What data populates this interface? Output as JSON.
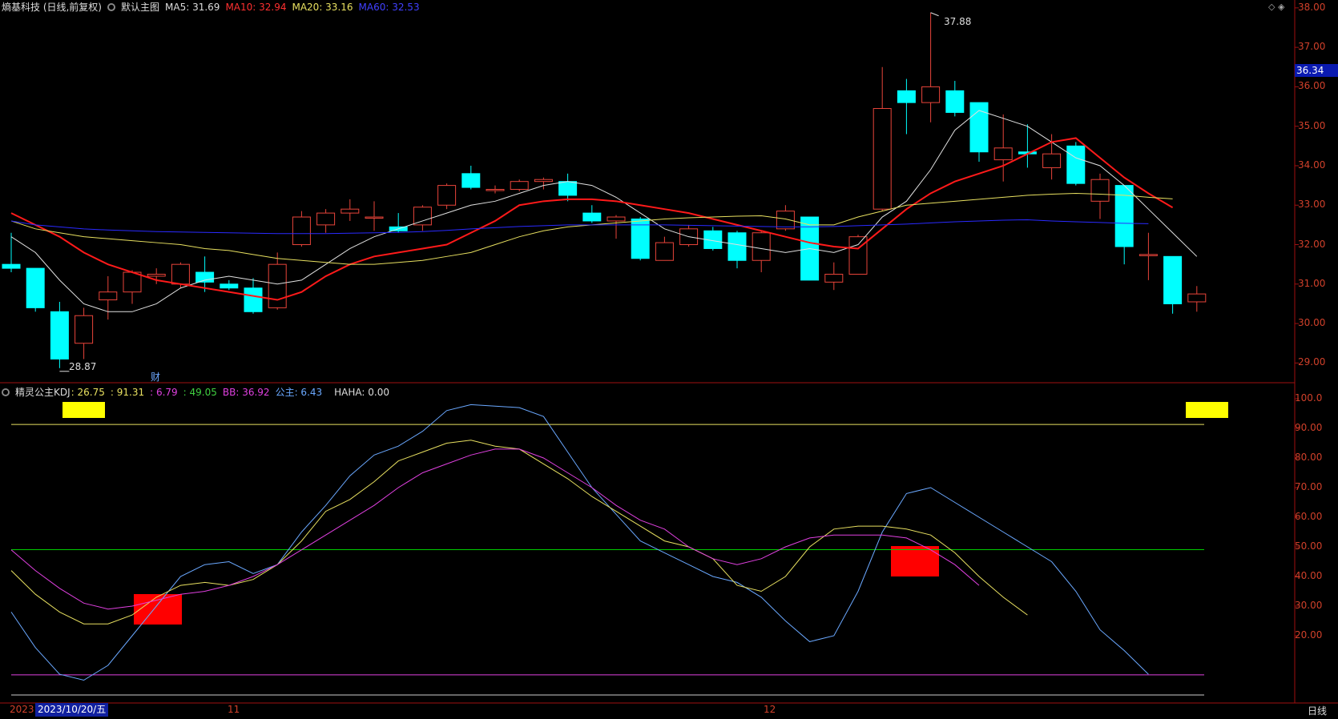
{
  "header": {
    "stock_title": "熵基科技 (日线,前复权)",
    "main_chart_btn": "默认主图",
    "ma5": "MA5: 31.69",
    "ma10": "MA10: 32.94",
    "ma20": "MA20: 33.16",
    "ma60": "MA60: 32.53",
    "window_controls": "◇ ◈"
  },
  "indicator_header": {
    "name": "精灵公主KDJ",
    "v1": ": 26.75",
    "v2": ": 91.31",
    "v3": ": 6.79",
    "v4": ": 49.05",
    "bb": "BB: 36.92",
    "gongzhu": "公主: 6.43",
    "haha": "HAHA: 0.00"
  },
  "colors": {
    "up": "#e8443a",
    "down": "#00ffff",
    "ma5": "#e0e0e0",
    "ma10": "#ff1a1a",
    "ma20": "#e8e060",
    "ma60": "#2a2aff",
    "k": "#6aa8ff",
    "d": "#e8e060",
    "j": "#e040e0",
    "mid": "#00cc00",
    "marker_red": "#ff0000",
    "marker_yellow": "#ffff00"
  },
  "annotations": {
    "high": "37.88",
    "low": "28.87",
    "fin_marker": "财"
  },
  "price_axis": {
    "current": "36.34"
  },
  "x_axis": {
    "labels": [
      "2023",
      "11",
      "12"
    ],
    "cursor_date": "2023/10/20/五",
    "cycle": "日线"
  },
  "chart_data": [
    {
      "type": "candlestick",
      "title": "熵基科技 (日线,前复权)",
      "ylim": [
        28.5,
        38.2
      ],
      "yticks": [
        "38.00",
        "37.00",
        "36.00",
        "35.00",
        "34.00",
        "33.00",
        "32.00",
        "31.00",
        "30.00",
        "29.00"
      ],
      "candles": [
        {
          "o": 31.5,
          "c": 31.4,
          "h": 32.3,
          "l": 31.3
        },
        {
          "o": 31.4,
          "c": 30.4,
          "h": 31.4,
          "l": 30.3
        },
        {
          "o": 30.3,
          "c": 29.1,
          "h": 30.55,
          "l": 28.87
        },
        {
          "o": 29.5,
          "c": 30.2,
          "h": 30.4,
          "l": 29.1
        },
        {
          "o": 30.6,
          "c": 30.8,
          "h": 31.2,
          "l": 30.1
        },
        {
          "o": 30.8,
          "c": 31.3,
          "h": 31.35,
          "l": 30.5
        },
        {
          "o": 31.2,
          "c": 31.25,
          "h": 31.4,
          "l": 31.0
        },
        {
          "o": 31.0,
          "c": 31.5,
          "h": 31.55,
          "l": 30.9
        },
        {
          "o": 31.3,
          "c": 31.05,
          "h": 31.7,
          "l": 30.8
        },
        {
          "o": 31.0,
          "c": 30.9,
          "h": 31.1,
          "l": 30.85
        },
        {
          "o": 30.9,
          "c": 30.3,
          "h": 31.15,
          "l": 30.25
        },
        {
          "o": 30.4,
          "c": 31.5,
          "h": 31.8,
          "l": 30.35
        },
        {
          "o": 32.0,
          "c": 32.7,
          "h": 32.85,
          "l": 31.95
        },
        {
          "o": 32.5,
          "c": 32.8,
          "h": 32.9,
          "l": 32.3
        },
        {
          "o": 32.8,
          "c": 32.9,
          "h": 33.15,
          "l": 32.6
        },
        {
          "o": 32.7,
          "c": 32.7,
          "h": 33.1,
          "l": 32.35
        },
        {
          "o": 32.45,
          "c": 32.35,
          "h": 32.8,
          "l": 32.3
        },
        {
          "o": 32.5,
          "c": 32.95,
          "h": 33.0,
          "l": 32.35
        },
        {
          "o": 33.0,
          "c": 33.5,
          "h": 33.55,
          "l": 32.9
        },
        {
          "o": 33.8,
          "c": 33.45,
          "h": 34.0,
          "l": 33.4
        },
        {
          "o": 33.4,
          "c": 33.4,
          "h": 33.5,
          "l": 33.3
        },
        {
          "o": 33.4,
          "c": 33.6,
          "h": 33.65,
          "l": 33.35
        },
        {
          "o": 33.6,
          "c": 33.65,
          "h": 33.7,
          "l": 33.4
        },
        {
          "o": 33.6,
          "c": 33.25,
          "h": 33.8,
          "l": 33.1
        },
        {
          "o": 32.8,
          "c": 32.6,
          "h": 33.0,
          "l": 32.55
        },
        {
          "o": 32.6,
          "c": 32.7,
          "h": 32.75,
          "l": 32.15
        },
        {
          "o": 32.65,
          "c": 31.65,
          "h": 32.7,
          "l": 31.6
        },
        {
          "o": 31.6,
          "c": 32.05,
          "h": 32.2,
          "l": 31.6
        },
        {
          "o": 32.0,
          "c": 32.4,
          "h": 32.5,
          "l": 31.95
        },
        {
          "o": 32.35,
          "c": 31.9,
          "h": 32.45,
          "l": 31.85
        },
        {
          "o": 32.3,
          "c": 31.6,
          "h": 32.35,
          "l": 31.4
        },
        {
          "o": 31.6,
          "c": 32.3,
          "h": 32.35,
          "l": 31.3
        },
        {
          "o": 32.4,
          "c": 32.85,
          "h": 33.0,
          "l": 32.35
        },
        {
          "o": 32.7,
          "c": 31.1,
          "h": 32.7,
          "l": 31.1
        },
        {
          "o": 31.05,
          "c": 31.25,
          "h": 31.55,
          "l": 30.85
        },
        {
          "o": 31.25,
          "c": 32.2,
          "h": 32.25,
          "l": 31.25
        },
        {
          "o": 32.9,
          "c": 35.45,
          "h": 36.5,
          "l": 32.85
        },
        {
          "o": 35.9,
          "c": 35.6,
          "h": 36.2,
          "l": 34.8
        },
        {
          "o": 35.6,
          "c": 36.0,
          "h": 37.88,
          "l": 35.1
        },
        {
          "o": 35.9,
          "c": 35.35,
          "h": 36.15,
          "l": 35.25
        },
        {
          "o": 35.6,
          "c": 34.35,
          "h": 35.6,
          "l": 34.1
        },
        {
          "o": 34.15,
          "c": 34.45,
          "h": 35.3,
          "l": 33.6
        },
        {
          "o": 34.35,
          "c": 34.3,
          "h": 35.05,
          "l": 33.95
        },
        {
          "o": 33.95,
          "c": 34.3,
          "h": 34.8,
          "l": 33.65
        },
        {
          "o": 34.5,
          "c": 33.55,
          "h": 34.6,
          "l": 33.5
        },
        {
          "o": 33.1,
          "c": 33.65,
          "h": 33.8,
          "l": 32.65
        },
        {
          "o": 33.5,
          "c": 31.95,
          "h": 33.5,
          "l": 31.5
        },
        {
          "o": 31.75,
          "c": 31.75,
          "h": 32.3,
          "l": 31.1
        },
        {
          "o": 31.7,
          "c": 30.5,
          "h": 31.7,
          "l": 30.25
        },
        {
          "o": 30.55,
          "c": 30.75,
          "h": 30.95,
          "l": 30.3
        }
      ],
      "series": [
        {
          "name": "MA5",
          "values": [
            32.2,
            31.8,
            31.1,
            30.5,
            30.3,
            30.3,
            30.5,
            30.9,
            31.1,
            31.2,
            31.1,
            31.0,
            31.1,
            31.5,
            31.9,
            32.2,
            32.4,
            32.6,
            32.8,
            33.0,
            33.1,
            33.3,
            33.5,
            33.6,
            33.5,
            33.2,
            32.8,
            32.4,
            32.2,
            32.1,
            32.0,
            31.9,
            31.8,
            31.9,
            31.8,
            32.0,
            32.7,
            33.1,
            33.9,
            34.9,
            35.4,
            35.2,
            35.0,
            34.6,
            34.2,
            34.0,
            33.5,
            32.9,
            32.3,
            31.7
          ]
        },
        {
          "name": "MA10",
          "values": [
            32.8,
            32.5,
            32.2,
            31.8,
            31.5,
            31.3,
            31.1,
            31.0,
            30.9,
            30.8,
            30.7,
            30.6,
            30.8,
            31.2,
            31.5,
            31.7,
            31.8,
            31.9,
            32.0,
            32.3,
            32.6,
            33.0,
            33.1,
            33.15,
            33.15,
            33.1,
            33.0,
            32.9,
            32.8,
            32.65,
            32.5,
            32.35,
            32.2,
            32.05,
            31.95,
            31.9,
            32.4,
            32.9,
            33.3,
            33.6,
            33.8,
            34.0,
            34.3,
            34.6,
            34.7,
            34.2,
            33.7,
            33.3,
            32.94
          ]
        },
        {
          "name": "MA20",
          "values": [
            32.6,
            32.4,
            32.3,
            32.2,
            32.15,
            32.1,
            32.05,
            32.0,
            31.9,
            31.85,
            31.75,
            31.65,
            31.6,
            31.55,
            31.5,
            31.5,
            31.55,
            31.6,
            31.7,
            31.8,
            32.0,
            32.2,
            32.35,
            32.45,
            32.5,
            32.55,
            32.6,
            32.65,
            32.68,
            32.7,
            32.72,
            32.73,
            32.65,
            32.5,
            32.5,
            32.7,
            32.85,
            33.0,
            33.05,
            33.1,
            33.15,
            33.2,
            33.25,
            33.28,
            33.3,
            33.28,
            33.25,
            33.2,
            33.16
          ]
        },
        {
          "name": "MA60",
          "values": [
            32.6,
            32.5,
            32.45,
            32.4,
            32.37,
            32.35,
            32.33,
            32.32,
            32.31,
            32.3,
            32.29,
            32.28,
            32.28,
            32.28,
            32.29,
            32.3,
            32.31,
            32.33,
            32.36,
            32.4,
            32.43,
            32.46,
            32.48,
            32.5,
            32.5,
            32.5,
            32.5,
            32.5,
            32.49,
            32.48,
            32.47,
            32.46,
            32.45,
            32.45,
            32.46,
            32.48,
            32.5,
            32.52,
            32.55,
            32.58,
            32.6,
            32.62,
            32.63,
            32.6,
            32.58,
            32.56,
            32.54,
            32.53
          ]
        }
      ]
    },
    {
      "type": "line",
      "title": "精灵公主KDJ",
      "ylim": [
        0,
        105
      ],
      "yticks": [
        "100.0",
        "90.00",
        "80.00",
        "70.00",
        "60.00",
        "50.00",
        "40.00",
        "30.00",
        "20.00"
      ],
      "hlines": [
        {
          "value": 91.31,
          "color": "#e8e060"
        },
        {
          "value": 49.05,
          "color": "#00cc00"
        },
        {
          "value": 6.79,
          "color": "#e040e0"
        },
        {
          "value": 0,
          "color": "#cccccc"
        }
      ],
      "series": [
        {
          "name": "K",
          "values": [
            28,
            16,
            7,
            5,
            10,
            20,
            30,
            40,
            44,
            45,
            41,
            44,
            55,
            64,
            74,
            81,
            84,
            89,
            96,
            98,
            97.5,
            97,
            94,
            82,
            70,
            61,
            52,
            48,
            44,
            40,
            38,
            33,
            25,
            18,
            20,
            35,
            55,
            68,
            70,
            65,
            60,
            55,
            50,
            45,
            35,
            22,
            15,
            7
          ]
        },
        {
          "name": "D",
          "values": [
            42,
            34,
            28,
            24,
            24,
            27,
            33,
            37,
            38,
            37,
            39,
            44,
            52,
            62,
            66,
            72,
            79,
            82,
            85,
            86,
            84,
            83,
            78,
            73,
            67,
            62,
            57,
            52,
            50,
            46,
            37,
            35,
            40,
            50,
            56,
            57,
            57,
            56,
            54,
            48,
            40,
            33,
            27
          ]
        },
        {
          "name": "J",
          "values": [
            49,
            42,
            36,
            31,
            29,
            30,
            32,
            34,
            35,
            37,
            40,
            44,
            49,
            54,
            59,
            64,
            70,
            75,
            78,
            81,
            83,
            83,
            80,
            75,
            70,
            64,
            59,
            56,
            50,
            46,
            44,
            46,
            50,
            53,
            54,
            54,
            54,
            53,
            49,
            44,
            37
          ]
        }
      ]
    }
  ]
}
